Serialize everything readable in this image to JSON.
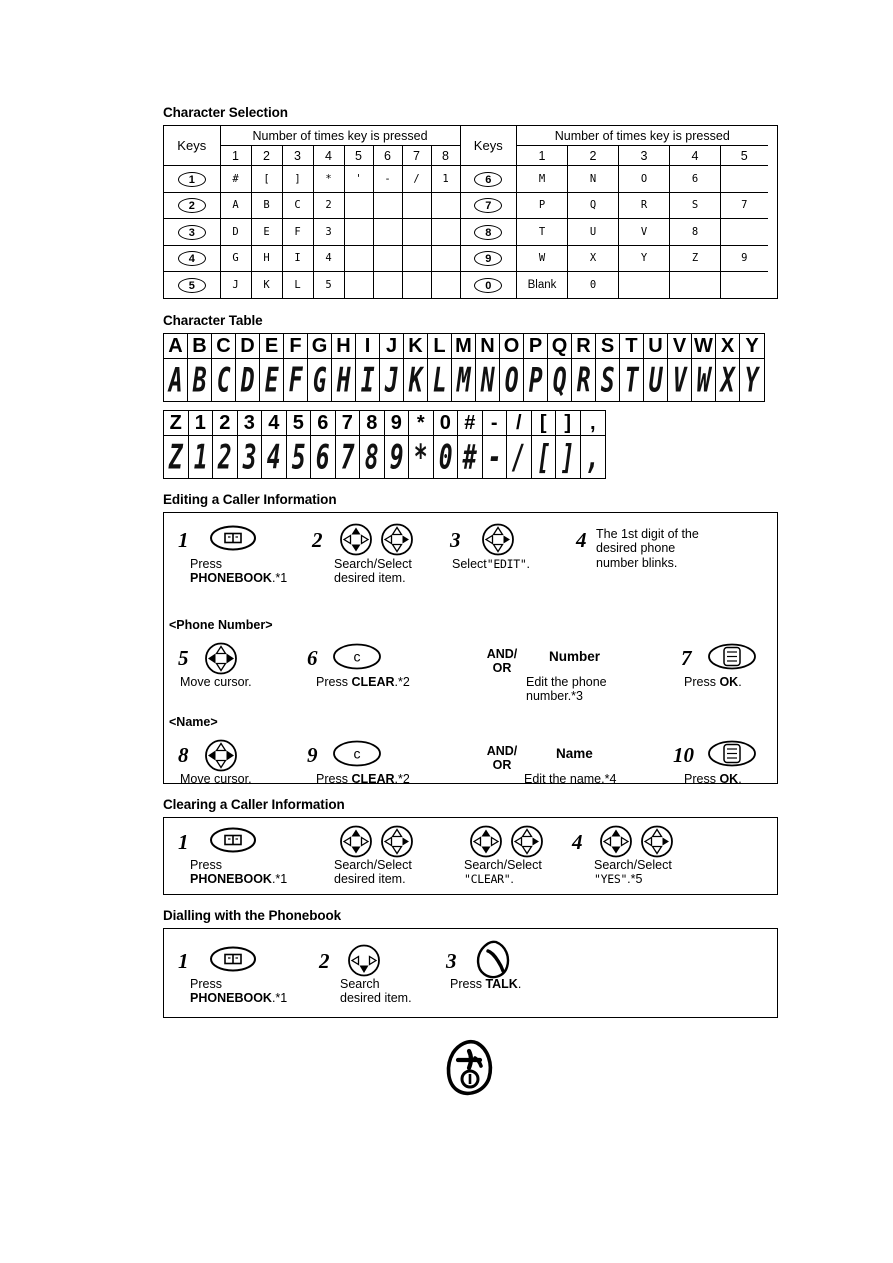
{
  "sections": {
    "char_selection": {
      "title": "Character Selection",
      "left_table": {
        "keys_header": "Keys",
        "press_header": "Number of times key is pressed",
        "press_counts": [
          "1",
          "2",
          "3",
          "4",
          "5",
          "6",
          "7",
          "8"
        ],
        "rows": [
          {
            "key": "1",
            "chars": [
              "#",
              "[",
              "]",
              "*",
              "'",
              "-",
              "/",
              "1"
            ]
          },
          {
            "key": "2",
            "chars": [
              "A",
              "B",
              "C",
              "2",
              "",
              "",
              "",
              ""
            ]
          },
          {
            "key": "3",
            "chars": [
              "D",
              "E",
              "F",
              "3",
              "",
              "",
              "",
              ""
            ]
          },
          {
            "key": "4",
            "chars": [
              "G",
              "H",
              "I",
              "4",
              "",
              "",
              "",
              ""
            ]
          },
          {
            "key": "5",
            "chars": [
              "J",
              "K",
              "L",
              "5",
              "",
              "",
              "",
              ""
            ]
          }
        ]
      },
      "right_table": {
        "keys_header": "Keys",
        "press_header": "Number of times key is pressed",
        "press_counts": [
          "1",
          "2",
          "3",
          "4",
          "5"
        ],
        "rows": [
          {
            "key": "6",
            "chars": [
              "M",
              "N",
              "O",
              "6",
              ""
            ]
          },
          {
            "key": "7",
            "chars": [
              "P",
              "Q",
              "R",
              "S",
              "7"
            ]
          },
          {
            "key": "8",
            "chars": [
              "T",
              "U",
              "V",
              "8",
              ""
            ]
          },
          {
            "key": "9",
            "chars": [
              "W",
              "X",
              "Y",
              "Z",
              "9"
            ]
          },
          {
            "key": "0",
            "chars": [
              "Blank",
              "0",
              "",
              "",
              ""
            ]
          }
        ]
      }
    },
    "char_table": {
      "title": "Character Table",
      "row1": [
        "A",
        "B",
        "C",
        "D",
        "E",
        "F",
        "G",
        "H",
        "I",
        "J",
        "K",
        "L",
        "M",
        "N",
        "O",
        "P",
        "Q",
        "R",
        "S",
        "T",
        "U",
        "V",
        "W",
        "X",
        "Y"
      ],
      "row2": [
        "Z",
        "1",
        "2",
        "3",
        "4",
        "5",
        "6",
        "7",
        "8",
        "9",
        "*",
        "0",
        "#",
        "-",
        "/",
        "[",
        "]",
        ","
      ]
    },
    "editing": {
      "title": "Editing a Caller Information",
      "group1_label": "<Phone Number>",
      "group2_label": "<Name>",
      "steps": [
        {
          "num": "1",
          "icon": "phonebook-icon",
          "line1": "Press",
          "line2_bold": "PHONEBOOK",
          "line2_tail": ".*1"
        },
        {
          "num": "2",
          "icon": "joystick-pair-icon",
          "line1": "Search/Select",
          "line2": "desired item."
        },
        {
          "num": "3",
          "icon": "joystick-right-icon",
          "line1": "Select",
          "quoted": "\"EDIT\"",
          "tail": "."
        },
        {
          "num": "4",
          "line1": "The 1st digit of the",
          "line2": "desired phone",
          "line3": "number blinks."
        },
        {
          "num": "5",
          "icon": "joystick-lr-icon",
          "line1": "Move cursor."
        },
        {
          "num": "6",
          "icon": "clear-icon",
          "line1": "Press",
          "line2_bold": "CLEAR",
          "line2_tail": ".*2"
        },
        {
          "num": "",
          "andor": "AND/\nOR"
        },
        {
          "num": "",
          "heading": "Number",
          "line1": "Edit the phone",
          "line2": "number.*3"
        },
        {
          "num": "7",
          "icon": "ok-icon",
          "line1": "Press",
          "line2_bold": "OK",
          "line2_tail": "."
        },
        {
          "num": "8",
          "icon": "joystick-lr-icon",
          "line1": "Move cursor."
        },
        {
          "num": "9",
          "icon": "clear-icon",
          "line1": "Press",
          "line2_bold": "CLEAR",
          "line2_tail": ".*2"
        },
        {
          "num": "",
          "andor": "AND/\nOR"
        },
        {
          "num": "",
          "heading": "Name",
          "line1": "Edit the name.*4"
        },
        {
          "num": "10",
          "icon": "ok-icon",
          "line1": "Press",
          "line2_bold": "OK",
          "line2_tail": "."
        }
      ]
    },
    "clearing": {
      "title": "Clearing a Caller Information",
      "steps": [
        {
          "num": "1",
          "icon": "phonebook-icon",
          "line1": "Press",
          "line2_bold": "PHONEBOOK",
          "line2_tail": ".*1"
        },
        {
          "num": "",
          "icon": "joystick-pair-icon",
          "line1": "Search/Select",
          "line2": "desired item."
        },
        {
          "num": "",
          "icon": "joystick-pair-icon",
          "line1": "Search/Select",
          "quoted": "\"CLEAR\"",
          "tail": "."
        },
        {
          "num": "4",
          "icon": "joystick-pair-icon",
          "line1": "Search/Select",
          "quoted": "\"YES\"",
          "tail": ".*5"
        }
      ]
    },
    "dialling": {
      "title": "Dialling with the Phonebook",
      "steps": [
        {
          "num": "1",
          "icon": "phonebook-icon",
          "line1": "Press",
          "line2_bold": "PHONEBOOK",
          "line2_tail": ".*1"
        },
        {
          "num": "2",
          "icon": "joystick-updown-icon",
          "line1": "Search",
          "line2": "desired item."
        },
        {
          "num": "3",
          "icon": "talk-icon",
          "line1": "Press",
          "line2_bold": "TALK",
          "line2_tail": "."
        }
      ]
    },
    "footer": {
      "icon": "phone-off-icon"
    }
  },
  "colors": {
    "ink": "#000000",
    "paper": "#ffffff"
  }
}
